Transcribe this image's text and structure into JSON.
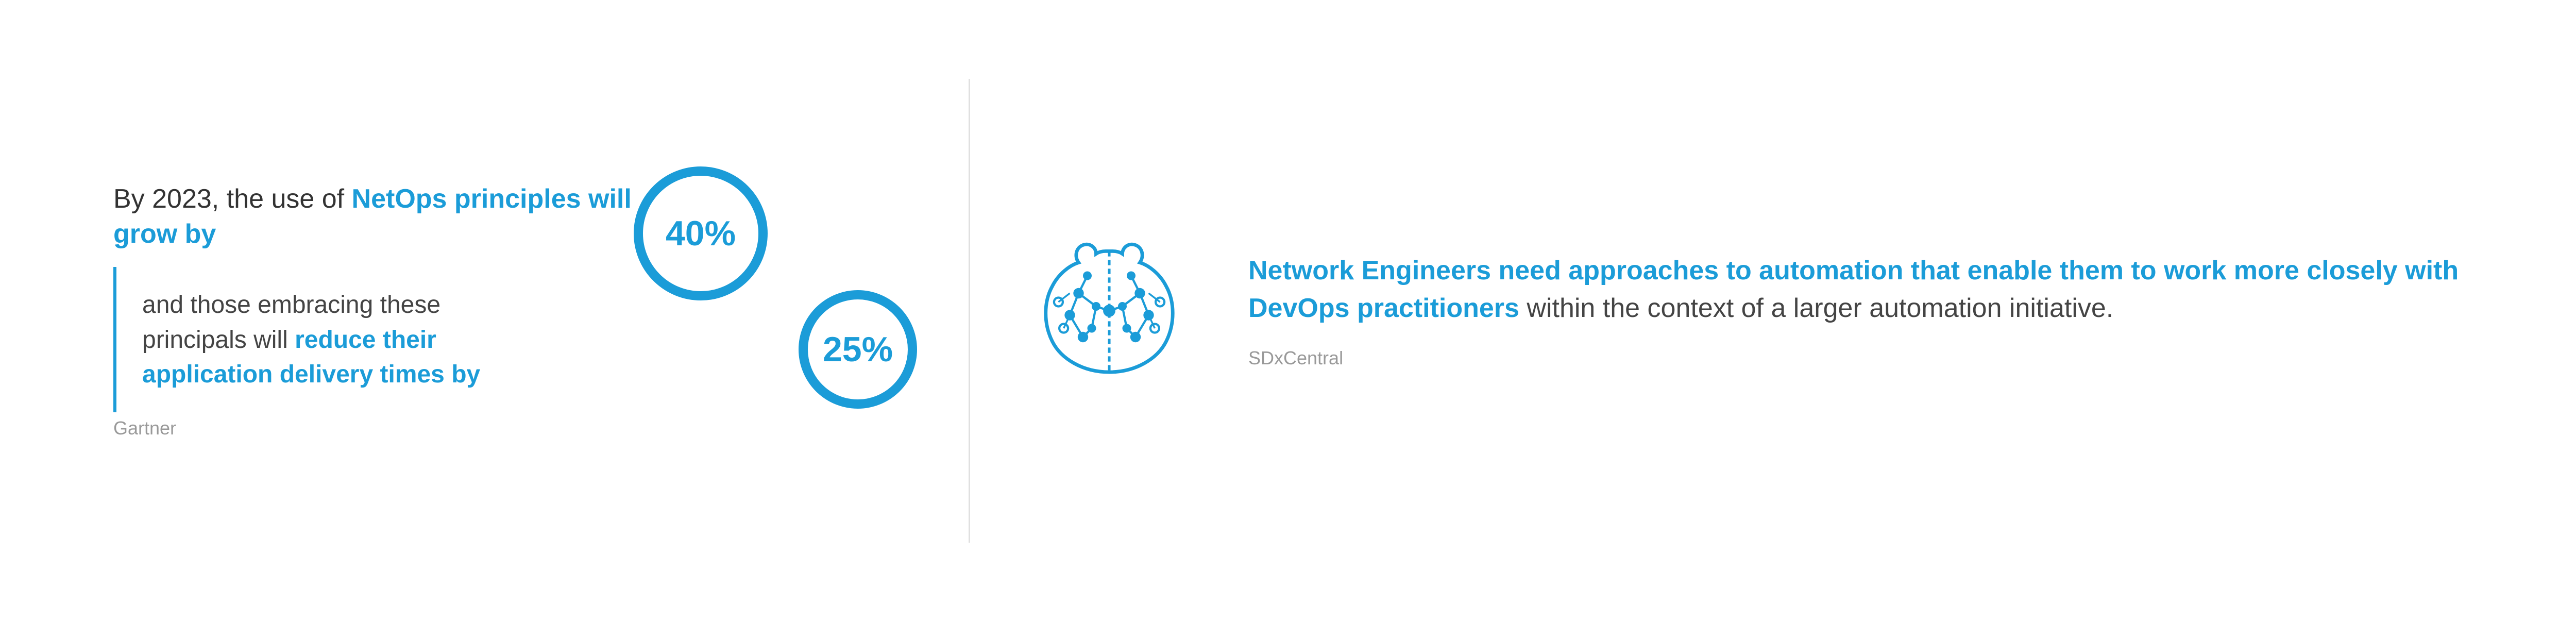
{
  "left": {
    "intro": {
      "prefix": "By 2023, the use of ",
      "highlight": "NetOps principles will grow by",
      "highlight_text": "NetOps"
    },
    "stat1": {
      "percent": "40%"
    },
    "body": {
      "prefix": "and those embracing these principals will ",
      "highlight": "reduce their application delivery times by",
      "highlight_text_1": "reduce their",
      "highlight_text_2": "application delivery",
      "highlight_text_3": "times by"
    },
    "stat2": {
      "percent": "25%"
    },
    "source": "Gartner"
  },
  "right": {
    "quote": {
      "highlight": "Network Engineers need approaches to automation that enable them to work more closely with DevOps practitioners",
      "suffix": " within the context of a larger automation initiative."
    },
    "source": "SDxCentral",
    "brain_icon": "brain-circuit-icon"
  }
}
